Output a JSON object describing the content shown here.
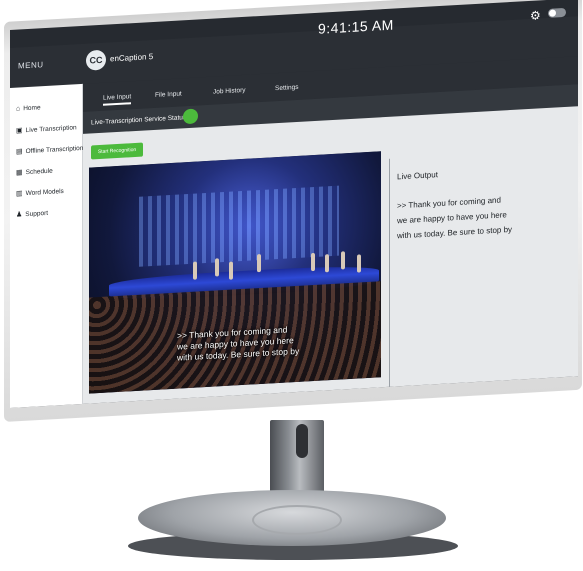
{
  "app": {
    "menu_label": "MENU",
    "logo_text": "CC",
    "name": "enCaption 5",
    "clock": "9:41:15 AM",
    "icons": {
      "settings": "gear-icon",
      "toggle": "toggle-switch-icon"
    }
  },
  "sidebar": {
    "items": [
      {
        "label": "Home",
        "icon": "home-icon"
      },
      {
        "label": "Live Transcription",
        "icon": "live-transcription-icon"
      },
      {
        "label": "Offline Transcription",
        "icon": "offline-transcription-icon"
      },
      {
        "label": "Schedule",
        "icon": "calendar-icon"
      },
      {
        "label": "Word Models",
        "icon": "book-icon"
      },
      {
        "label": "Support",
        "icon": "users-icon"
      }
    ]
  },
  "tabs": [
    {
      "label": "Live Input",
      "active": true
    },
    {
      "label": "File Input",
      "active": false
    },
    {
      "label": "Job History",
      "active": false
    },
    {
      "label": "Settings",
      "active": false
    }
  ],
  "status": {
    "label": "Live-Transcription Service Status",
    "color": "#4cba3c"
  },
  "controls": {
    "start_button": "Start Recognition"
  },
  "video": {
    "caption_line1": ">> Thank you for coming and",
    "caption_line2": "we are happy to have you here",
    "caption_line3": "with us today. Be sure to stop by"
  },
  "live_output": {
    "title": "Live Output",
    "line1": ">> Thank you for coming and",
    "line2": "we are happy to have you here",
    "line3": "with us today. Be sure to stop by"
  },
  "colors": {
    "accent_green": "#4cba3c",
    "header_dark": "#2b2f35"
  }
}
